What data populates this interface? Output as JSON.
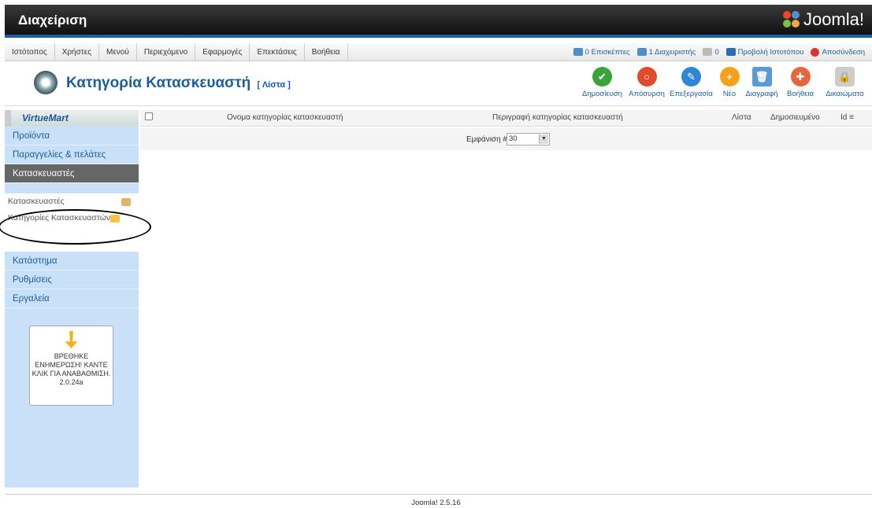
{
  "admin_title": "Διαχείριση",
  "logo": "Joomla!",
  "menu": [
    "Ιστότοπος",
    "Χρήστες",
    "Μενού",
    "Περιεχόμενο",
    "Εφαρμογές",
    "Επεκτάσεις",
    "Βοήθεια"
  ],
  "status": {
    "visitors": "0 Επισκέπτες",
    "admins": "1 Διαχειριστής",
    "messages": "0",
    "view_site": "Προβολή Ιστοτόπου",
    "logout": "Αποσύνδεση"
  },
  "page": {
    "title": "Κατηγορία Κατασκευαστή",
    "subtitle": "[ Λίστα ]"
  },
  "toolbar": {
    "publish": "Δημοσίευση",
    "unpublish": "Απόσυρση",
    "edit": "Επεξεργασία",
    "new": "Νέο",
    "delete": "Διαγραφή",
    "help": "Βοήθεια",
    "permissions": "Δικαιώματα"
  },
  "sidebar": {
    "logo": "VirtueMart",
    "items": [
      "Προϊόντα",
      "Παραγγελίες & πελάτες",
      "Κατασκευαστές"
    ],
    "sub": [
      "Κατασκευαστές",
      "Κατηγορίες Κατασκευαστών"
    ],
    "items2": [
      "Κατάστημα",
      "Ρυθμίσεις",
      "Εργαλεία"
    ],
    "update": "ΒΡΕΘΗΚΕ ΕΝΗΜΕΡΩΣΗ! ΚΑΝΤΕ ΚΛΙΚ ΓΙΑ ΑΝΑΒΑΘΜΙΣΗ. 2.0.24a"
  },
  "table": {
    "headers": {
      "name": "Ονομα κατηγορίας κατασκευαστή",
      "description": "Περιγραφή κατηγορίας κατασκευαστή",
      "list": "Λίστα",
      "published": "Δημοσιευμένο",
      "id": "Id"
    },
    "display_label": "Εμφάνιση #",
    "display_value": "30"
  },
  "footer": "Joomla! 2.5.16",
  "colors": {
    "accent": "#1a5e9c",
    "sidebar": "#c8e1f8"
  }
}
